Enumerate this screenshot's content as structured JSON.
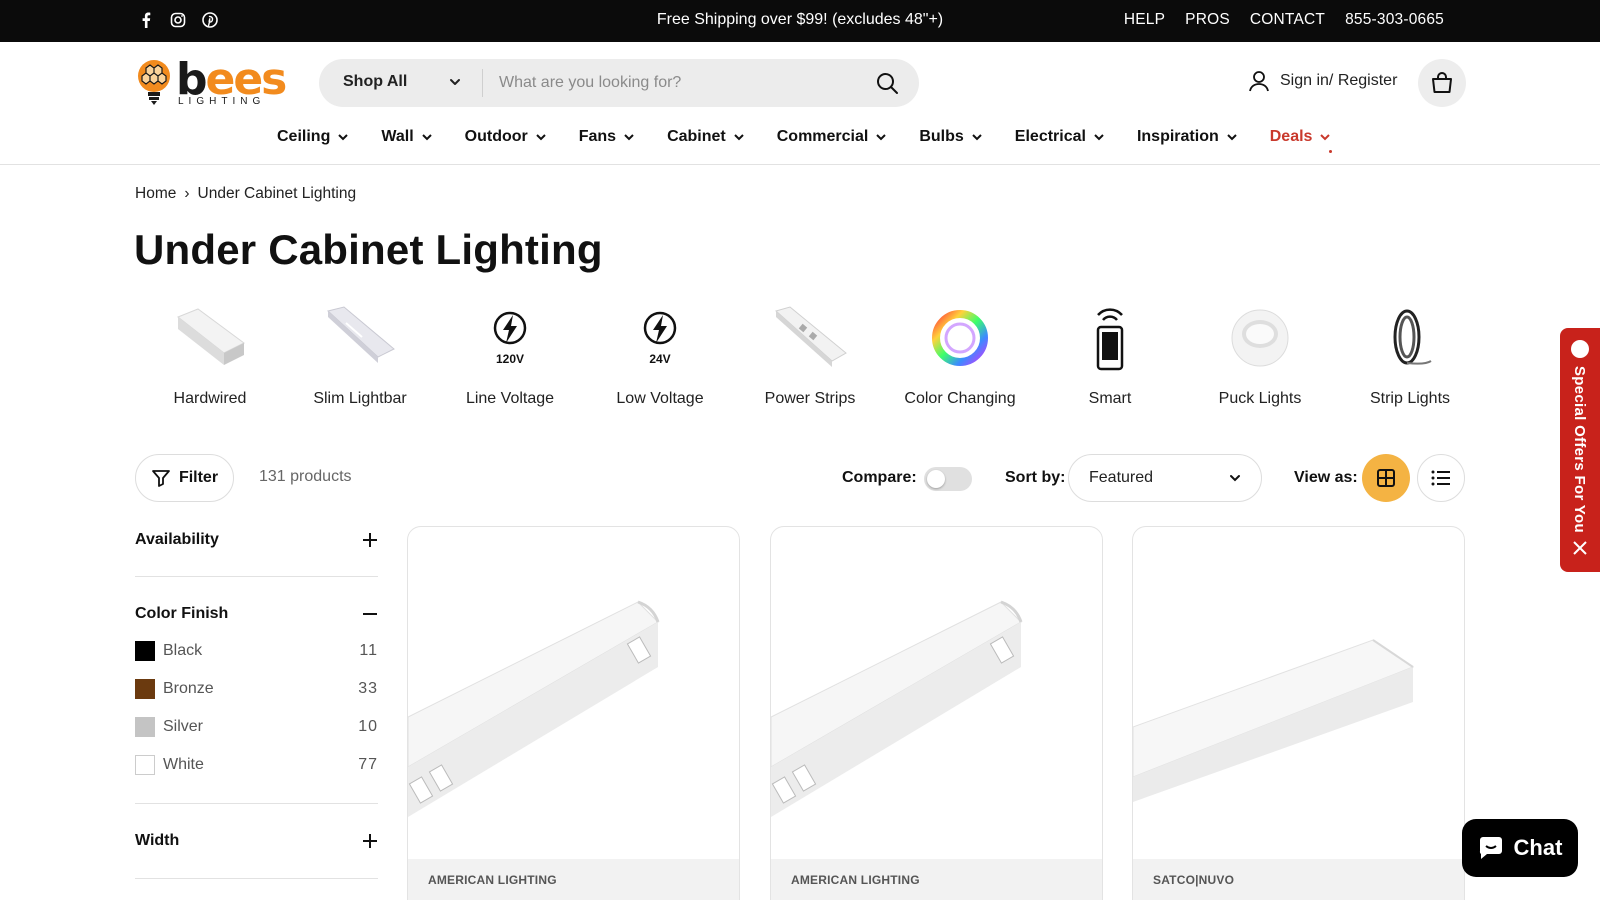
{
  "topbar": {
    "social": [
      "facebook-icon",
      "instagram-icon",
      "pinterest-icon"
    ],
    "announcement": "Free Shipping over $99! (excludes 48\"+)",
    "links": [
      "HELP",
      "PROS",
      "CONTACT",
      "855-303-0665"
    ]
  },
  "header": {
    "logo_word_b": "b",
    "logo_word_ees": "ees",
    "logo_sub": "LIGHTING",
    "search": {
      "category": "Shop All",
      "placeholder": "What are you looking for?"
    },
    "signin": "Sign in/ Register"
  },
  "nav": [
    "Ceiling",
    "Wall",
    "Outdoor",
    "Fans",
    "Cabinet",
    "Commercial",
    "Bulbs",
    "Electrical",
    "Inspiration",
    "Deals"
  ],
  "breadcrumb": {
    "home": "Home",
    "sep": "›",
    "current": "Under Cabinet Lighting"
  },
  "page_title": "Under Cabinet Lighting",
  "categories": [
    {
      "label": "Hardwired",
      "icon": "hardwired-light-icon"
    },
    {
      "label": "Slim Lightbar",
      "icon": "slim-lightbar-icon"
    },
    {
      "label": "Line Voltage",
      "icon": "lightning-icon",
      "badge": "120V"
    },
    {
      "label": "Low Voltage",
      "icon": "lightning-icon",
      "badge": "24V"
    },
    {
      "label": "Power Strips",
      "icon": "power-strip-icon"
    },
    {
      "label": "Color Changing",
      "icon": "color-ring-icon"
    },
    {
      "label": "Smart",
      "icon": "smartphone-icon"
    },
    {
      "label": "Puck Lights",
      "icon": "puck-light-icon"
    },
    {
      "label": "Strip Lights",
      "icon": "strip-light-icon"
    }
  ],
  "toolbar": {
    "filter": "Filter",
    "count": "131 products",
    "compare": "Compare:",
    "sort_label": "Sort by:",
    "sort_value": "Featured",
    "view_label": "View as:"
  },
  "filters": {
    "availability": "Availability",
    "color_finish": "Color Finish",
    "colors": [
      {
        "name": "Black",
        "count": "11",
        "color": "#000000"
      },
      {
        "name": "Bronze",
        "count": "33",
        "color": "#6b3a0f"
      },
      {
        "name": "Silver",
        "count": "10",
        "color": "#c4c4c4"
      },
      {
        "name": "White",
        "count": "77",
        "color": "#ffffff"
      }
    ],
    "width": "Width"
  },
  "products": [
    {
      "brand": "AMERICAN LIGHTING"
    },
    {
      "brand": "AMERICAN LIGHTING"
    },
    {
      "brand": "SATCO|NUVO"
    }
  ],
  "offers_tab": "Special Offers For You",
  "chat": "Chat",
  "colors": {
    "accent": "#f4b343",
    "deals": "#c9392c",
    "offers": "#c8221b"
  }
}
